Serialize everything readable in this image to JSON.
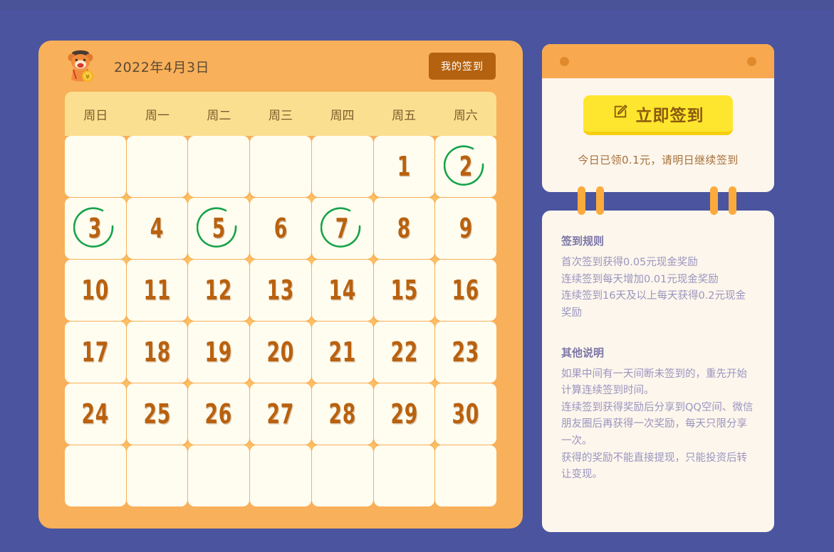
{
  "theme": {
    "page_bg": "#4b549f",
    "card_orange": "#f8b05a",
    "weekday_bg": "#fbdf90",
    "cell_bg": "#fffdf0",
    "day_number_color": "#b9610f",
    "checked_ring_color": "#16a34a",
    "signin_button_bg": "#ffe62e",
    "signin_button_text": "#8a5a0e",
    "rules_text_color": "#9a95c0",
    "rules_title_color": "#7b76a8",
    "my_signin_button_bg": "#b4620f"
  },
  "calendar": {
    "title": "2022年4月3日",
    "mascot_icon": "bear-mascot-with-coin-icon",
    "my_signin_button": "我的签到",
    "weekdays": [
      "周日",
      "周一",
      "周二",
      "周三",
      "周四",
      "周五",
      "周六"
    ],
    "leading_blanks": 5,
    "trailing_blanks": 7,
    "days": [
      {
        "num": "1",
        "checked": false
      },
      {
        "num": "2",
        "checked": true
      },
      {
        "num": "3",
        "checked": true
      },
      {
        "num": "4",
        "checked": false
      },
      {
        "num": "5",
        "checked": true
      },
      {
        "num": "6",
        "checked": false
      },
      {
        "num": "7",
        "checked": true
      },
      {
        "num": "8",
        "checked": false
      },
      {
        "num": "9",
        "checked": false
      },
      {
        "num": "10",
        "checked": false
      },
      {
        "num": "11",
        "checked": false
      },
      {
        "num": "12",
        "checked": false
      },
      {
        "num": "13",
        "checked": false
      },
      {
        "num": "14",
        "checked": false
      },
      {
        "num": "15",
        "checked": false
      },
      {
        "num": "16",
        "checked": false
      },
      {
        "num": "17",
        "checked": false
      },
      {
        "num": "18",
        "checked": false
      },
      {
        "num": "19",
        "checked": false
      },
      {
        "num": "20",
        "checked": false
      },
      {
        "num": "21",
        "checked": false
      },
      {
        "num": "22",
        "checked": false
      },
      {
        "num": "23",
        "checked": false
      },
      {
        "num": "24",
        "checked": false
      },
      {
        "num": "25",
        "checked": false
      },
      {
        "num": "26",
        "checked": false
      },
      {
        "num": "27",
        "checked": false
      },
      {
        "num": "28",
        "checked": false
      },
      {
        "num": "29",
        "checked": false
      },
      {
        "num": "30",
        "checked": false
      }
    ]
  },
  "signin_panel": {
    "button_icon": "edit-pencil-square-icon",
    "button_label": "立即签到",
    "status_text": "今日已领0.1元，请明日继续签到",
    "hole_icon": "punch-hole-icon"
  },
  "rules_panel": {
    "sections": [
      {
        "title": "签到规则",
        "lines": [
          "首次签到获得0.05元现金奖励",
          "连续签到每天增加0.01元现金奖励",
          "连续签到16天及以上每天获得0.2元现金奖励"
        ]
      },
      {
        "title": "其他说明",
        "lines": [
          "如果中间有一天间断未签到的，重先开始计算连续签到时间。",
          "连续签到获得奖励后分享到QQ空间、微信朋友圈后再获得一次奖励，每天只限分享一次。",
          "获得的奖励不能直接提现，只能投资后转让变现。"
        ]
      }
    ]
  }
}
